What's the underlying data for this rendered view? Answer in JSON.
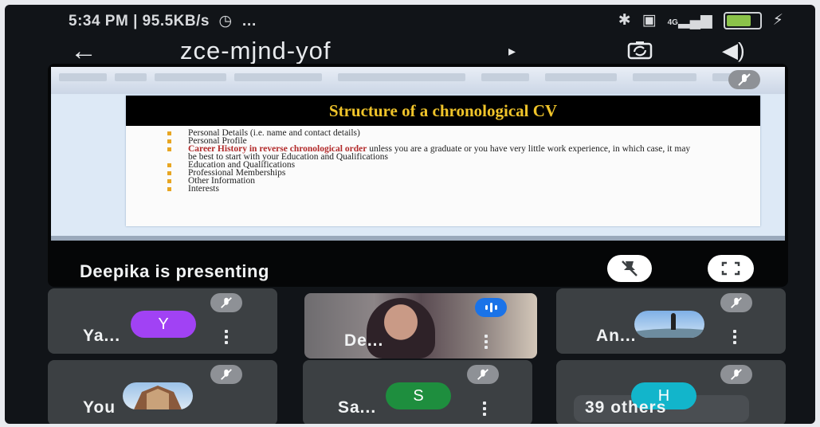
{
  "status_bar": {
    "time_speed": "5:34 PM | 95.5KB/s",
    "extra": "…",
    "signal_label": "4G",
    "battery_level": 0.7,
    "battery_color": "#8bc34a"
  },
  "header": {
    "meeting_code": "zce-mjnd-yof",
    "caret": "▸"
  },
  "presentation": {
    "slide_title": "Structure of a chronological CV",
    "bullets": [
      {
        "text": "Personal Details (i.e. name and contact details)"
      },
      {
        "text": "Personal Profile"
      },
      {
        "highlight": "Career History in reverse chronological order",
        "text": " unless you are a graduate or you have very little work experience, in which case, it may be best to start with your Education and Qualifications"
      },
      {
        "text": "Education and Qualifications"
      },
      {
        "text": "Professional Memberships"
      },
      {
        "text": "Other Information"
      },
      {
        "text": "Interests"
      }
    ],
    "presenting_label": "Deepika is presenting"
  },
  "participants": [
    {
      "name": "Ya...",
      "initial": "Y",
      "avatar_color": "#a142f4"
    },
    {
      "name": "De...",
      "speaking": true
    },
    {
      "name": "An..."
    },
    {
      "name": "You"
    },
    {
      "name": "Sa...",
      "initial": "S",
      "avatar_color": "#1e8e3e"
    },
    {
      "name": "39 others",
      "initial": "H",
      "avatar_color": "#12b5cb"
    }
  ],
  "colors": {
    "accent_blue": "#1a73e8",
    "tile_bg": "#3c4043",
    "slide_title_text": "#f0c42a",
    "bullet_highlight": "#b22a2a"
  },
  "icons": [
    "back-arrow-icon",
    "switch-camera-icon",
    "speaker-icon",
    "mic-off-icon",
    "pin-off-icon",
    "fullscreen-icon",
    "more-vert-icon",
    "speaking-indicator-icon",
    "bluetooth-icon",
    "wifi-icon",
    "signal-icon",
    "battery-icon"
  ]
}
